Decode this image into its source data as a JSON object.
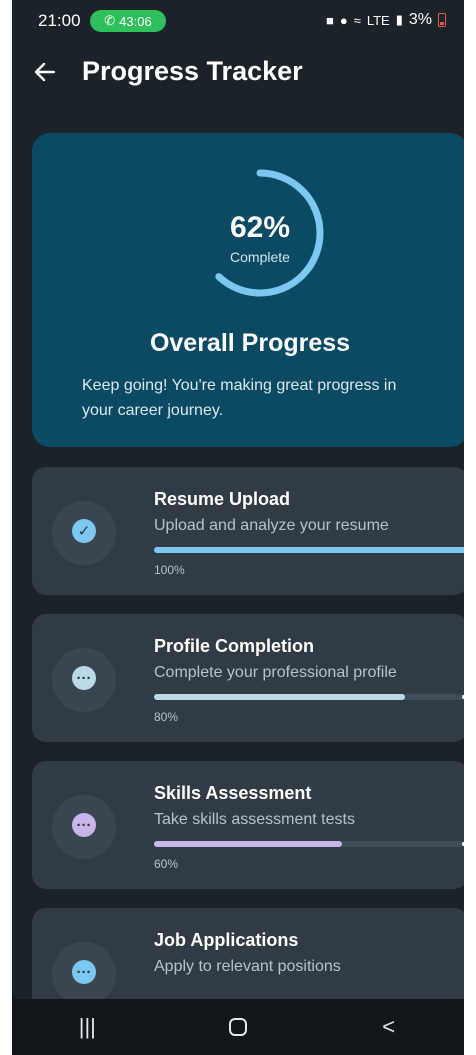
{
  "status_bar": {
    "time": "21:00",
    "call_duration": "43:06",
    "network_label": "LTE",
    "battery": "3%"
  },
  "header": {
    "title": "Progress Tracker"
  },
  "overview": {
    "percent_text": "62%",
    "percent_value": 62,
    "subtitle": "Complete",
    "title": "Overall Progress",
    "description": "Keep going! You're making great progress in your career journey.",
    "ring_color": "#7cc8f0"
  },
  "tasks": [
    {
      "name": "Resume Upload",
      "description": "Upload and analyze your resume",
      "progress_text": "100%",
      "progress": 100,
      "color": "#7cc8f0",
      "icon": "check-icon"
    },
    {
      "name": "Profile Completion",
      "description": "Complete your professional profile",
      "progress_text": "80%",
      "progress": 80,
      "color": "#bcd9e8",
      "icon": "ellipsis-icon"
    },
    {
      "name": "Skills Assessment",
      "description": "Take skills assessment tests",
      "progress_text": "60%",
      "progress": 60,
      "color": "#c9b6e8",
      "icon": "ellipsis-icon"
    },
    {
      "name": "Job Applications",
      "description": "Apply to relevant positions",
      "progress_text": "",
      "progress": null,
      "color": "#7cc8f0",
      "icon": "ellipsis-icon"
    }
  ],
  "nav": {
    "recents": "|||",
    "back": "<"
  }
}
